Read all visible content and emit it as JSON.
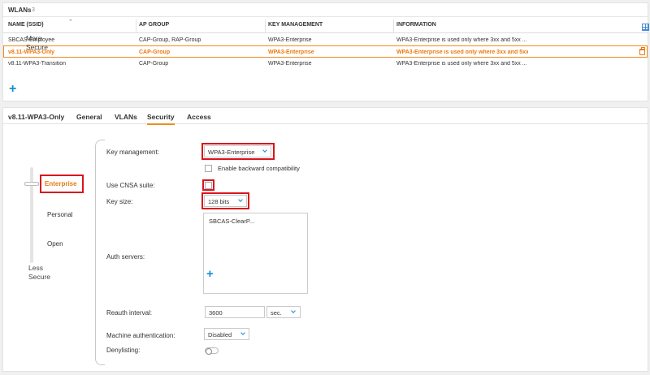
{
  "wlan_panel": {
    "title": "WLANs",
    "count": "3",
    "columns": [
      "NAME (SSID)",
      "AP GROUP",
      "KEY MANAGEMENT",
      "INFORMATION"
    ],
    "rows": [
      {
        "name": "SBCAS-Employee",
        "ap_group": "CAP-Group, RAP-Group",
        "key_mgmt": "WPA3-Enterprise",
        "info": "WPA3-Enterprise is used only where 3xx and 5xx ..."
      },
      {
        "name": "v8.11-WPA3-Only",
        "ap_group": "CAP-Group",
        "key_mgmt": "WPA3-Enterprise",
        "info": "WPA3-Enterprise is used only where 3xx and 5xx ..."
      },
      {
        "name": "v8.11-WPA3-Transition",
        "ap_group": "CAP-Group",
        "key_mgmt": "WPA3-Enterprise",
        "info": "WPA3-Enterprise is used only where 3xx and 5xx ..."
      }
    ],
    "add_label": "+"
  },
  "detail": {
    "tabs": [
      "v8.11-WPA3-Only",
      "General",
      "VLANs",
      "Security",
      "Access"
    ],
    "security_levels": {
      "more": "More\nSecure",
      "more_line1": "More",
      "more_line2": "Secure",
      "less_line1": "Less",
      "less_line2": "Secure",
      "levels": [
        "Enterprise",
        "Personal",
        "Open"
      ]
    },
    "form": {
      "key_management_label": "Key management:",
      "key_management_value": "WPA3-Enterprise",
      "backward_compat_label": "Enable backward compatibility",
      "cnsa_label": "Use CNSA suite:",
      "key_size_label": "Key size:",
      "key_size_value": "128 bits",
      "auth_servers_label": "Auth servers:",
      "auth_server_item": "SBCAS-ClearP...",
      "auth_add": "+",
      "reauth_label": "Reauth interval:",
      "reauth_value": "3600",
      "reauth_unit": "sec.",
      "machine_auth_label": "Machine authentication:",
      "machine_auth_value": "Disabled",
      "denylisting_label": "Denylisting:"
    }
  },
  "colors": {
    "accent_orange": "#e87a10",
    "accent_blue": "#1a8ccd",
    "highlight_red": "#d9141c"
  }
}
